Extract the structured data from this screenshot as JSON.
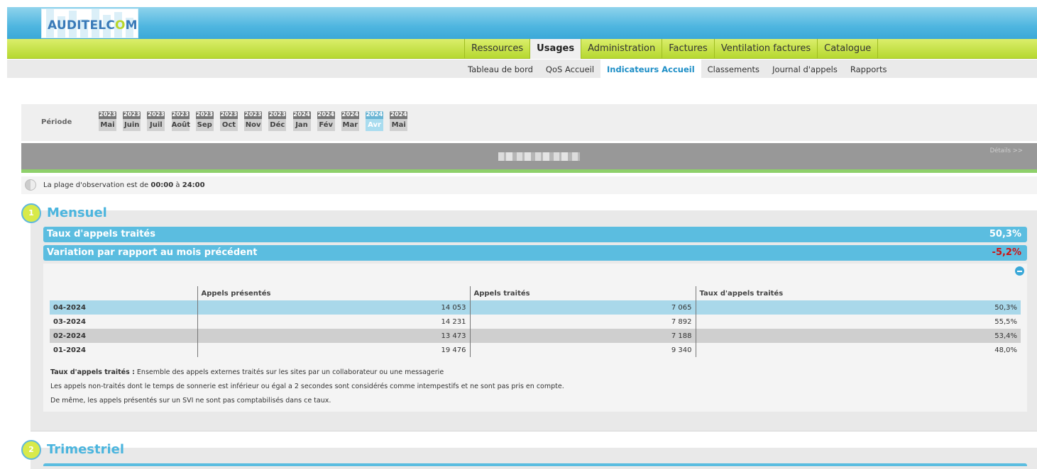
{
  "brand": {
    "logo_text": "AUDITELCOM"
  },
  "main_nav": {
    "items": [
      {
        "label": "Ressources",
        "active": false
      },
      {
        "label": "Usages",
        "active": true
      },
      {
        "label": "Administration",
        "active": false
      },
      {
        "label": "Factures",
        "active": false
      },
      {
        "label": "Ventilation factures",
        "active": false
      },
      {
        "label": "Catalogue",
        "active": false
      }
    ]
  },
  "sub_nav": {
    "items": [
      {
        "label": "Tableau de bord",
        "active": false
      },
      {
        "label": "QoS Accueil",
        "active": false
      },
      {
        "label": "Indicateurs Accueil",
        "active": true
      },
      {
        "label": "Classements",
        "active": false
      },
      {
        "label": "Journal d'appels",
        "active": false
      },
      {
        "label": "Rapports",
        "active": false
      }
    ]
  },
  "period": {
    "label": "Période",
    "months": [
      {
        "year": "2023",
        "month": "Mai",
        "selected": false
      },
      {
        "year": "2023",
        "month": "Juin",
        "selected": false
      },
      {
        "year": "2023",
        "month": "Juil",
        "selected": false
      },
      {
        "year": "2023",
        "month": "Août",
        "selected": false
      },
      {
        "year": "2023",
        "month": "Sep",
        "selected": false
      },
      {
        "year": "2023",
        "month": "Oct",
        "selected": false
      },
      {
        "year": "2023",
        "month": "Nov",
        "selected": false
      },
      {
        "year": "2023",
        "month": "Déc",
        "selected": false
      },
      {
        "year": "2024",
        "month": "Jan",
        "selected": false
      },
      {
        "year": "2024",
        "month": "Fév",
        "selected": false
      },
      {
        "year": "2024",
        "month": "Mar",
        "selected": false
      },
      {
        "year": "2024",
        "month": "Avr",
        "selected": true
      },
      {
        "year": "2024",
        "month": "Mai",
        "selected": false
      }
    ]
  },
  "site_bar": {
    "details_link": "Détails >>"
  },
  "observation": {
    "prefix": "La plage d'observation est de",
    "start": "00:00",
    "middle": "à",
    "end": "24:00"
  },
  "section1": {
    "number": "1",
    "title": "Mensuel",
    "kpis": [
      {
        "label": "Taux d'appels traités",
        "value": "50,3%",
        "negative": false
      },
      {
        "label": "Variation par rapport au mois précédent",
        "value": "-5,2%",
        "negative": true
      }
    ],
    "table": {
      "columns": [
        "",
        "Appels présentés",
        "Appels traités",
        "Taux d'appels traités"
      ],
      "rows": [
        {
          "period": "04-2024",
          "presented": "14 053",
          "handled": "7 065",
          "rate": "50,3%",
          "style": "hl"
        },
        {
          "period": "03-2024",
          "presented": "14 231",
          "handled": "7 892",
          "rate": "55,5%",
          "style": ""
        },
        {
          "period": "02-2024",
          "presented": "13 473",
          "handled": "7 188",
          "rate": "53,4%",
          "style": "gr"
        },
        {
          "period": "01-2024",
          "presented": "19 476",
          "handled": "9 340",
          "rate": "48,0%",
          "style": ""
        }
      ]
    },
    "notes": {
      "definition_term": "Taux d'appels traités :",
      "definition_text": "Ensemble des appels externes traités sur les sites par un collaborateur ou une messagerie",
      "line2": "Les appels non-traités dont le temps de sonnerie est inférieur ou égal a 2 secondes sont considérés comme intempestifs et ne sont pas pris en compte.",
      "line3": "De même, les appels présentés sur un SVI ne sont pas comptabilisés dans ce taux."
    }
  },
  "section2": {
    "number": "2",
    "title": "Trimestriel"
  },
  "colors": {
    "accent_blue": "#5bbde0",
    "nav_green": "#b6d830",
    "negative_red": "#d01010"
  }
}
